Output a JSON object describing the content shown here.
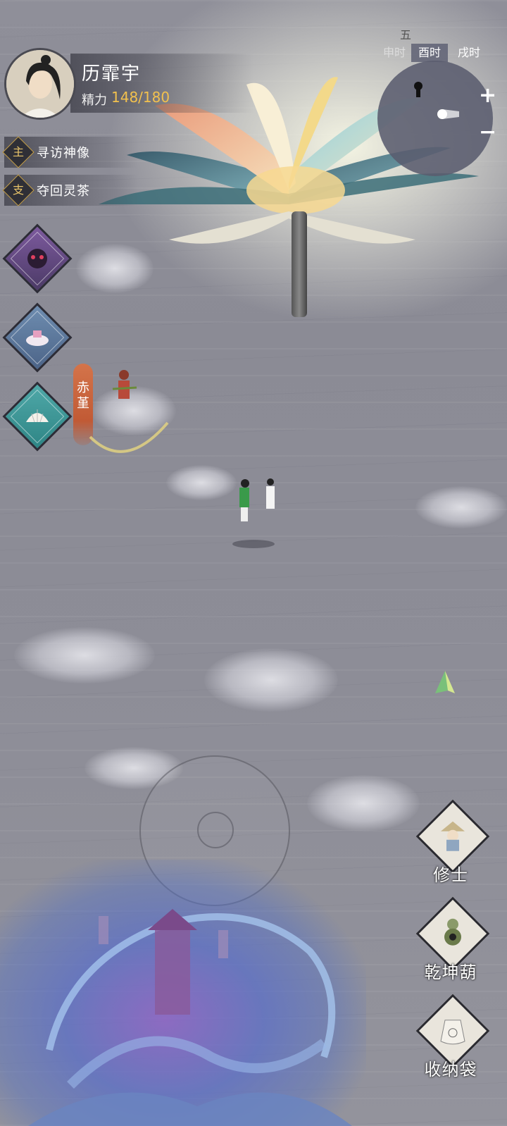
{
  "player": {
    "name": "历霏宇",
    "energy_label": "精力",
    "energy_value": "148/180"
  },
  "quests": [
    {
      "type": "主",
      "title": "寻访神像"
    },
    {
      "type": "支",
      "title": "夺回灵茶"
    }
  ],
  "time_tabs": [
    "申时",
    "酉时",
    "戌时"
  ],
  "active_time": "酉时",
  "location_top": "五",
  "minimap": {
    "zoom_in": "+",
    "zoom_out": "−"
  },
  "npc": {
    "name": "赤堇"
  },
  "actions": [
    {
      "label": "修士",
      "icon": "cultivator-icon"
    },
    {
      "label": "乾坤葫",
      "icon": "gourd-icon"
    },
    {
      "label": "收纳袋",
      "icon": "storage-bag-icon"
    }
  ],
  "skills": [
    "demon-mask-icon",
    "cloud-pavilion-icon",
    "shell-icon"
  ],
  "colors": {
    "accent": "#f2c14e",
    "npc_tag": "#c9603b",
    "minimap": "#5a5c6e"
  }
}
